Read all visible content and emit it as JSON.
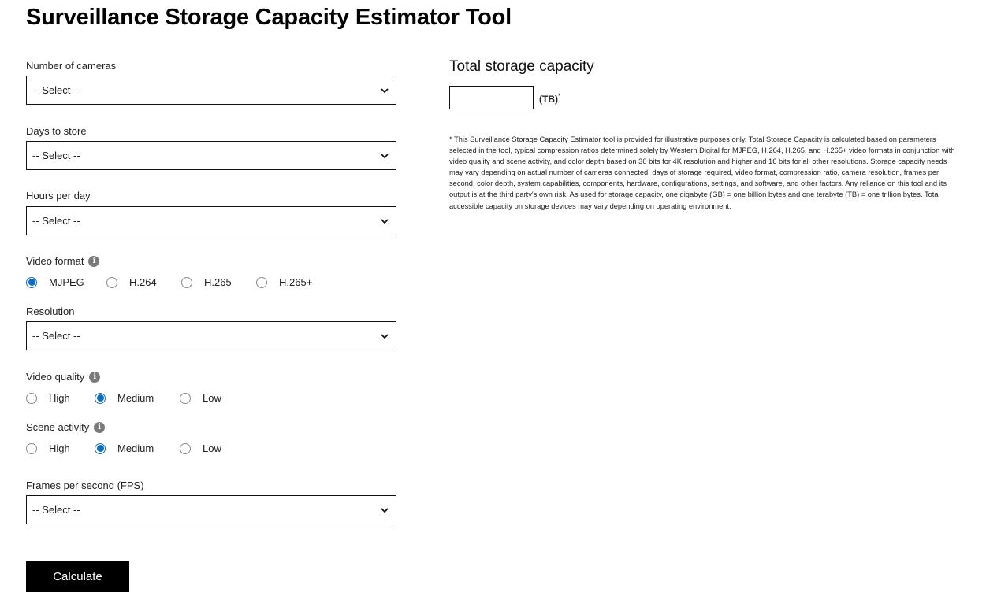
{
  "page": {
    "title": "Surveillance Storage Capacity Estimator Tool"
  },
  "form": {
    "cameras": {
      "label": "Number of cameras",
      "value": "-- Select --"
    },
    "days": {
      "label": "Days to store",
      "value": "-- Select --"
    },
    "hours": {
      "label": "Hours per day",
      "value": "-- Select --"
    },
    "video_format": {
      "label": "Video format",
      "info_icon": "info-icon",
      "options": [
        {
          "label": "MJPEG",
          "checked": true
        },
        {
          "label": "H.264",
          "checked": false
        },
        {
          "label": "H.265",
          "checked": false
        },
        {
          "label": "H.265+",
          "checked": false
        }
      ]
    },
    "resolution": {
      "label": "Resolution",
      "value": "-- Select --"
    },
    "video_quality": {
      "label": "Video quality",
      "info_icon": "info-icon",
      "options": [
        {
          "label": "High",
          "checked": false
        },
        {
          "label": "Medium",
          "checked": true
        },
        {
          "label": "Low",
          "checked": false
        }
      ]
    },
    "scene_activity": {
      "label": "Scene activity",
      "info_icon": "info-icon",
      "options": [
        {
          "label": "High",
          "checked": false
        },
        {
          "label": "Medium",
          "checked": true
        },
        {
          "label": "Low",
          "checked": false
        }
      ]
    },
    "fps": {
      "label": "Frames per second (FPS)",
      "value": "-- Select --"
    },
    "calculate_label": "Calculate"
  },
  "result": {
    "title": "Total storage capacity",
    "value": "",
    "unit": "(TB)",
    "unit_marker": "*",
    "disclaimer": "* This Surveillance Storage Capacity Estimator tool is provided for illustrative purposes only. Total Storage Capacity is calculated based on parameters selected in the tool, typical compression ratios determined solely by Western Digital for MJPEG, H.264, H.265, and H.265+ video formats in conjunction with video quality and scene activity, and color depth based on 30 bits for 4K resolution and higher and 16 bits for all other resolutions. Storage capacity needs may vary depending on actual number of cameras connected, days of storage required, video format, compression ratio, camera resolution, frames per second, color depth, system capabilities, components, hardware, configurations, settings, and software, and other factors. Any reliance on this tool and its output is at the third party's own risk. As used for storage capacity, one gigabyte (GB) = one billion bytes and one terabyte (TB) = one trillion bytes. Total accessible capacity on storage devices may vary depending on operating environment."
  },
  "colors": {
    "radio_checked": "#0f6cc2",
    "button_bg": "#000000",
    "info_icon": "#7a7a7a"
  }
}
